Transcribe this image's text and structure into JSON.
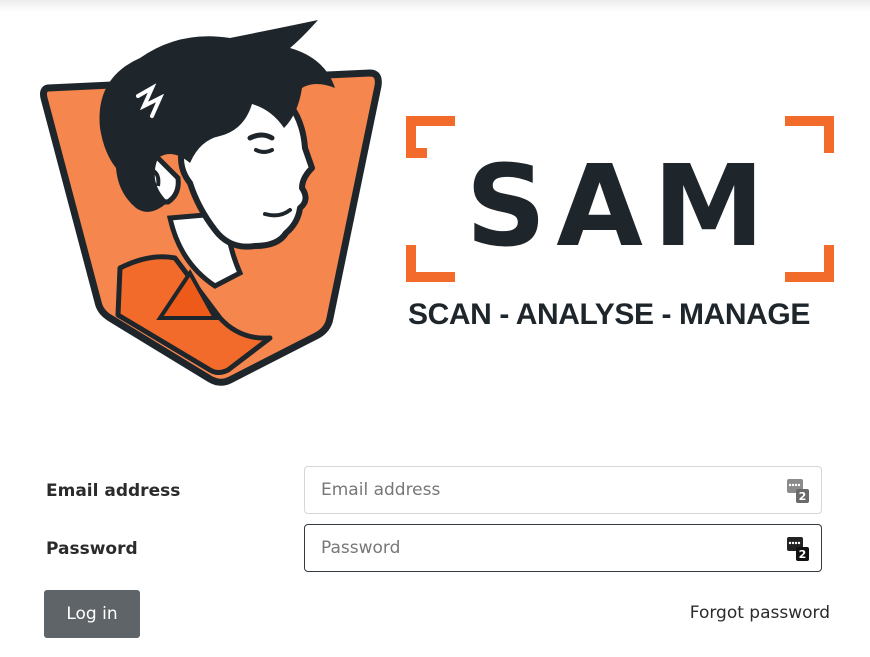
{
  "brand": {
    "name": "SAM",
    "tagline": "SCAN - ANALYSE - MANAGE",
    "colors": {
      "orange": "#f26b2a",
      "light_orange": "#f5864e",
      "dark": "#1f262b"
    },
    "icon": "mascot-logo"
  },
  "form": {
    "email": {
      "label": "Email address",
      "placeholder": "Email address",
      "value": ""
    },
    "password": {
      "label": "Password",
      "placeholder": "Password",
      "value": ""
    },
    "field_icon": "password-manager-icon",
    "login_label": "Log in",
    "forgot_label": "Forgot password"
  }
}
